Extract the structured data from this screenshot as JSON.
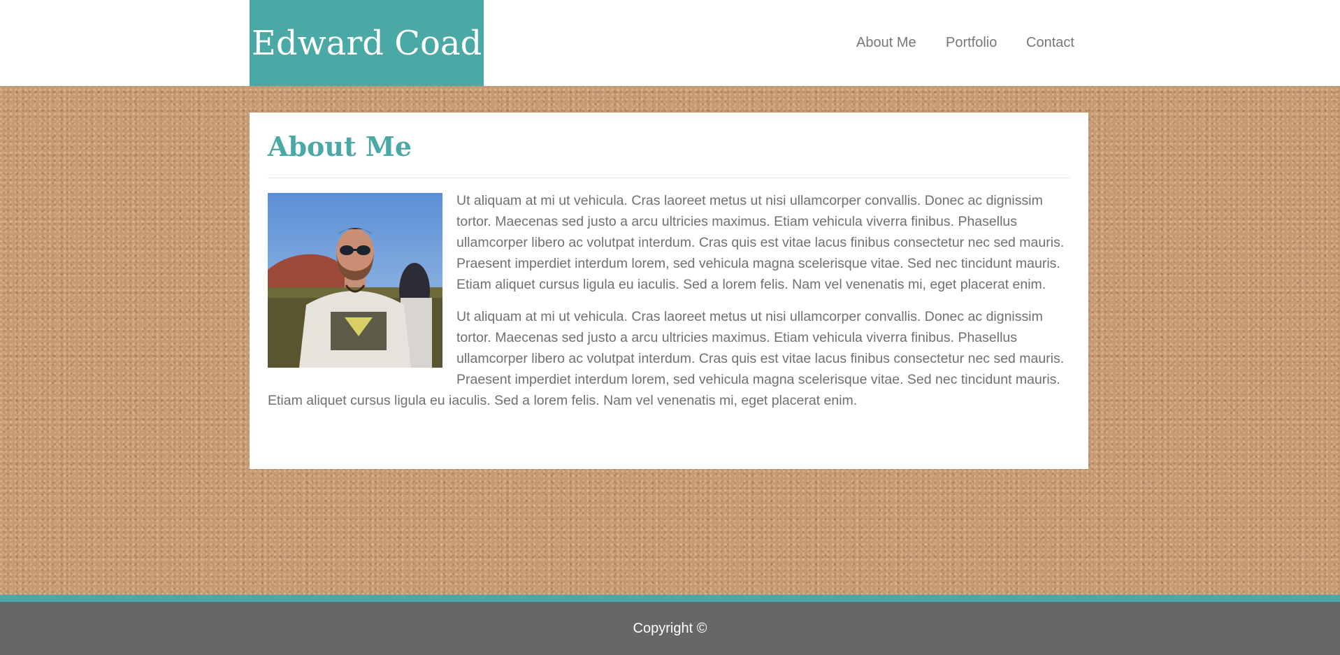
{
  "site": {
    "brand": "Edward Coad",
    "brand_color": "#4aa8a5",
    "background_color": "#c69a72"
  },
  "nav": {
    "items": [
      {
        "label": "About Me"
      },
      {
        "label": "Portfolio"
      },
      {
        "label": "Contact"
      }
    ]
  },
  "main": {
    "title": "About Me",
    "photo_icon": "profile-photo",
    "paragraphs": [
      "Ut aliquam at mi ut vehicula. Cras laoreet metus ut nisi ullamcorper convallis. Donec ac dignissim tortor. Maecenas sed justo a arcu ultricies maximus. Etiam vehicula viverra finibus. Phasellus ullamcorper libero ac volutpat interdum. Cras quis est vitae lacus finibus consectetur nec sed mauris. Praesent imperdiet interdum lorem, sed vehicula magna scelerisque vitae. Sed nec tincidunt mauris. Etiam aliquet cursus ligula eu iaculis. Sed a lorem felis. Nam vel venenatis mi, eget placerat enim.",
      "Ut aliquam at mi ut vehicula. Cras laoreet metus ut nisi ullamcorper convallis. Donec ac dignissim tortor. Maecenas sed justo a arcu ultricies maximus. Etiam vehicula viverra finibus. Phasellus ullamcorper libero ac volutpat interdum. Cras quis est vitae lacus finibus consectetur nec sed mauris. Praesent imperdiet interdum lorem, sed vehicula magna scelerisque vitae. Sed nec tincidunt mauris. Etiam aliquet cursus ligula eu iaculis. Sed a lorem felis. Nam vel venenatis mi, eget placerat enim."
    ]
  },
  "footer": {
    "copyright": "Copyright ©"
  }
}
